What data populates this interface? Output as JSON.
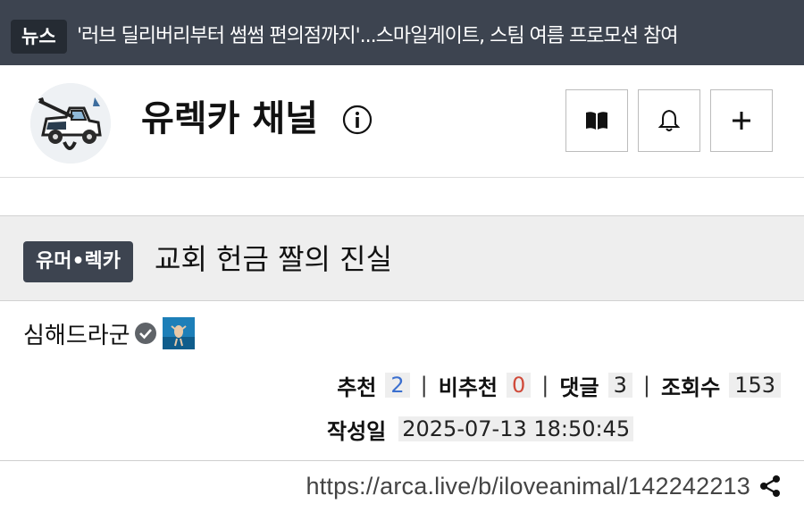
{
  "news": {
    "tag": "뉴스",
    "headline": "'러브 딜리버리부터 썸썸 편의점까지'...스마일게이트, 스팀 여름 프로모션 참여"
  },
  "channel": {
    "title": "유렉카 채널",
    "buttons": [
      "book-icon",
      "bell-icon",
      "plus-icon"
    ]
  },
  "article": {
    "category": "유머•렉카",
    "title": "교회 헌금 짤의 진실",
    "author": "심해드라군",
    "stats": {
      "recommend_label": "추천",
      "recommend": "2",
      "dislike_label": "비추천",
      "dislike": "0",
      "comments_label": "댓글",
      "comments": "3",
      "views_label": "조회수",
      "views": "153"
    },
    "date_label": "작성일",
    "date": "2025-07-13 18:50:45",
    "url": "https://arca.live/b/iloveanimal/142242213"
  },
  "colors": {
    "news_bg": "#3d4450",
    "recommend": "#3b6fcf",
    "dislike": "#d04a3a"
  }
}
